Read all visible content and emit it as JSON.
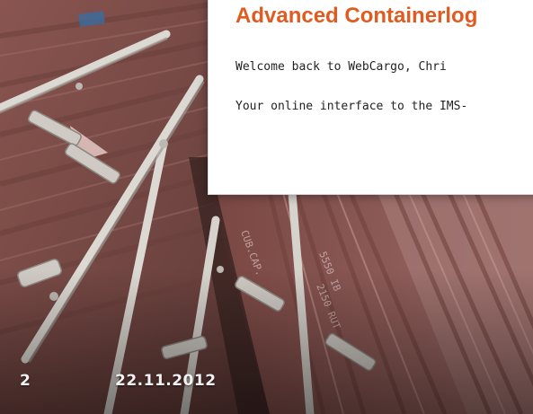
{
  "slide": {
    "page_number": "2",
    "date": "22.11.2012"
  },
  "panel": {
    "title": "Advanced Containerlog",
    "welcome": "Welcome back to WebCargo, Chri",
    "subtitle": "Your online interface to the IMS-"
  },
  "background": {
    "subject": "container-doors",
    "colors": {
      "container_red": "#7e4b47",
      "container_dark": "#4a2c2a",
      "steel_bar": "#d8d4cf",
      "sky": "#c9c9c9"
    }
  },
  "colors": {
    "title_orange": "#e15a1f",
    "text_dark": "#222222",
    "footer_text": "#f2f2f2"
  }
}
